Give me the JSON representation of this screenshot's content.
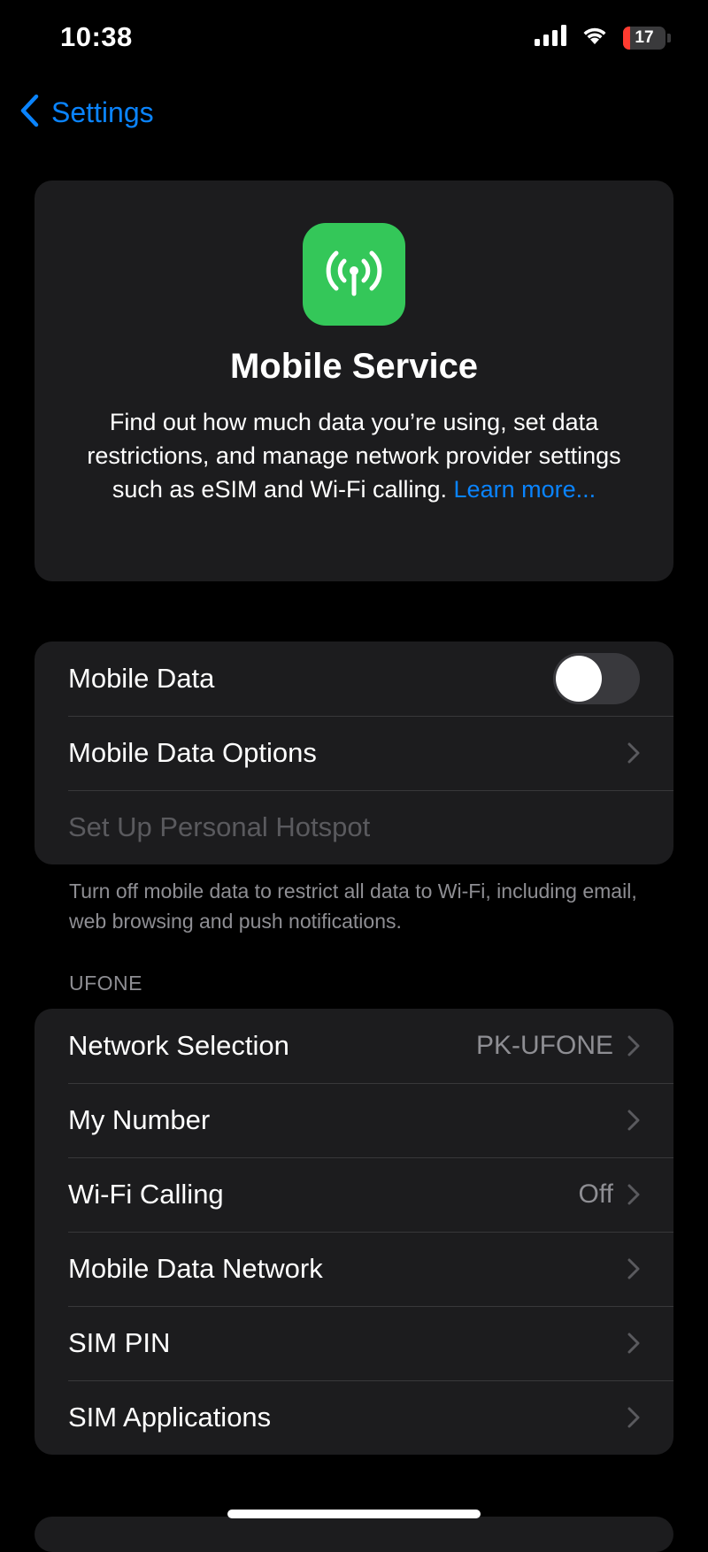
{
  "status_bar": {
    "time": "10:38",
    "battery_level": "17",
    "battery_fraction": 0.17,
    "battery_color": "#ff3b30"
  },
  "nav": {
    "back_label": "Settings"
  },
  "hero": {
    "icon": "antenna-radiowaves-icon",
    "title": "Mobile Service",
    "description": "Find out how much data you’re using, set data restrictions, and manage network provider settings such as eSIM and Wi-Fi calling.",
    "learn_more": "Learn more...",
    "icon_color": "#34c759"
  },
  "data_group": {
    "mobile_data": {
      "label": "Mobile Data",
      "enabled": false
    },
    "mobile_data_options": {
      "label": "Mobile Data Options"
    },
    "personal_hotspot": {
      "label": "Set Up Personal Hotspot",
      "disabled": true
    }
  },
  "footnote": "Turn off mobile data to restrict all data to Wi-Fi, including email, web browsing and push notifications.",
  "carrier_section": {
    "header": "UFONE",
    "rows": [
      {
        "label": "Network Selection",
        "value": "PK-UFONE"
      },
      {
        "label": "My Number",
        "value": ""
      },
      {
        "label": "Wi-Fi Calling",
        "value": "Off"
      },
      {
        "label": "Mobile Data Network",
        "value": ""
      },
      {
        "label": "SIM PIN",
        "value": ""
      },
      {
        "label": "SIM Applications",
        "value": ""
      }
    ]
  },
  "colors": {
    "accent": "#0a84ff",
    "card_bg": "#1c1c1e",
    "secondary_text": "#8e8e93"
  }
}
